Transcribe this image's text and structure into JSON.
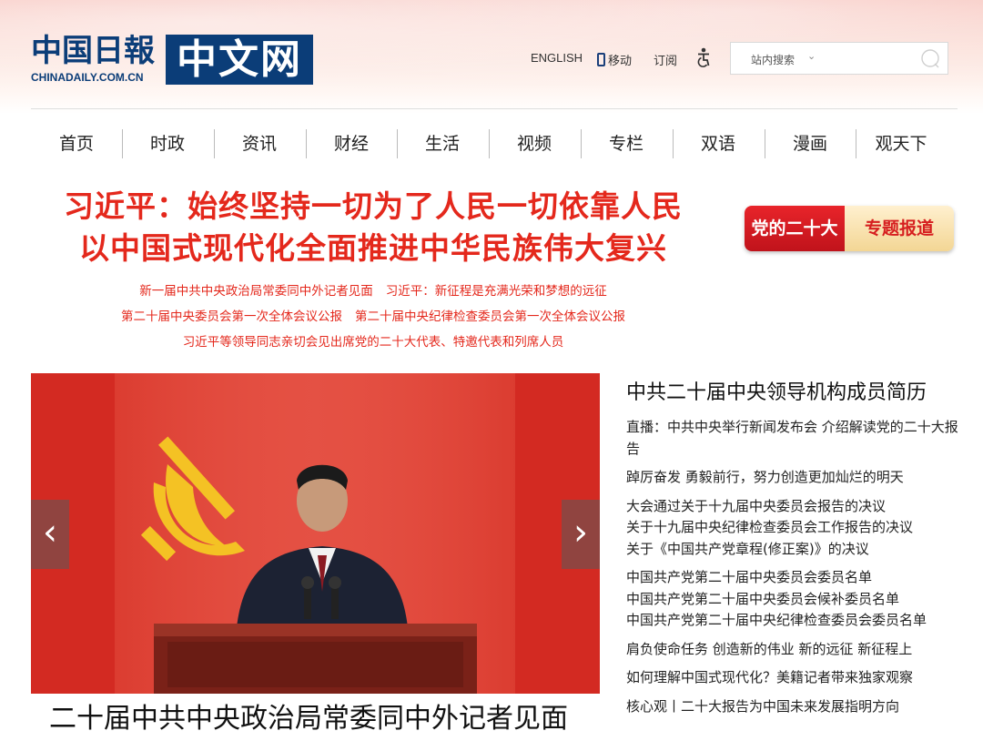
{
  "logo": {
    "cn": "中国日報",
    "en": "CHINADAILY.COM.CN",
    "box": "中文网"
  },
  "utility": {
    "english": "ENGLISH",
    "mobile": "移动",
    "subscribe": "订阅"
  },
  "search": {
    "scope": "站内搜索",
    "caret": "⌄"
  },
  "nav": [
    "首页",
    "时政",
    "资讯",
    "财经",
    "生活",
    "视频",
    "专栏",
    "双语",
    "漫画",
    "观天下"
  ],
  "headline": {
    "line1": "习近平：始终坚持一切为了人民一切依靠人民",
    "line2": "以中国式现代化全面推进中华民族伟大复兴"
  },
  "sub_links": {
    "row1": [
      "新一届中共中央政治局常委同中外记者见面",
      "习近平：新征程是充满光荣和梦想的远征"
    ],
    "row2": [
      "第二十届中央委员会第一次全体会议公报",
      "第二十届中央纪律检查委员会第一次全体会议公报"
    ],
    "row3": [
      "习近平等领导同志亲切会见出席党的二十大代表、特邀代表和列席人员"
    ]
  },
  "badge": {
    "left": "党的二十大",
    "right": "专题报道"
  },
  "hero": {
    "prev": "‹",
    "next": "›",
    "caption": "二十届中共中央政治局常委同中外记者见面"
  },
  "side": {
    "title": "中共二十届中央领导机构成员简历",
    "blocks": [
      [
        "直播：中共中央举行新闻发布会 介绍解读党的二十大报告"
      ],
      [
        "踔厉奋发 勇毅前行，努力创造更加灿烂的明天"
      ],
      [
        "大会通过关于十九届中央委员会报告的决议",
        "关于十九届中央纪律检查委员会工作报告的决议",
        "关于《中国共产党章程(修正案)》的决议"
      ],
      [
        "中国共产党第二十届中央委员会委员名单",
        "中国共产党第二十届中央委员会候补委员名单",
        "中国共产党第二十届中央纪律检查委员会委员名单"
      ],
      [
        "肩负使命任务 创造新的伟业 新的远征 新征程上"
      ],
      [
        "如何理解中国式现代化？美籍记者带来独家观察"
      ],
      [
        "核心观丨二十大报告为中国未来发展指明方向"
      ]
    ]
  },
  "colors": {
    "brand_blue": "#0b3d78",
    "headline_red": "#e4281c",
    "badge_red": "#d61f20"
  }
}
